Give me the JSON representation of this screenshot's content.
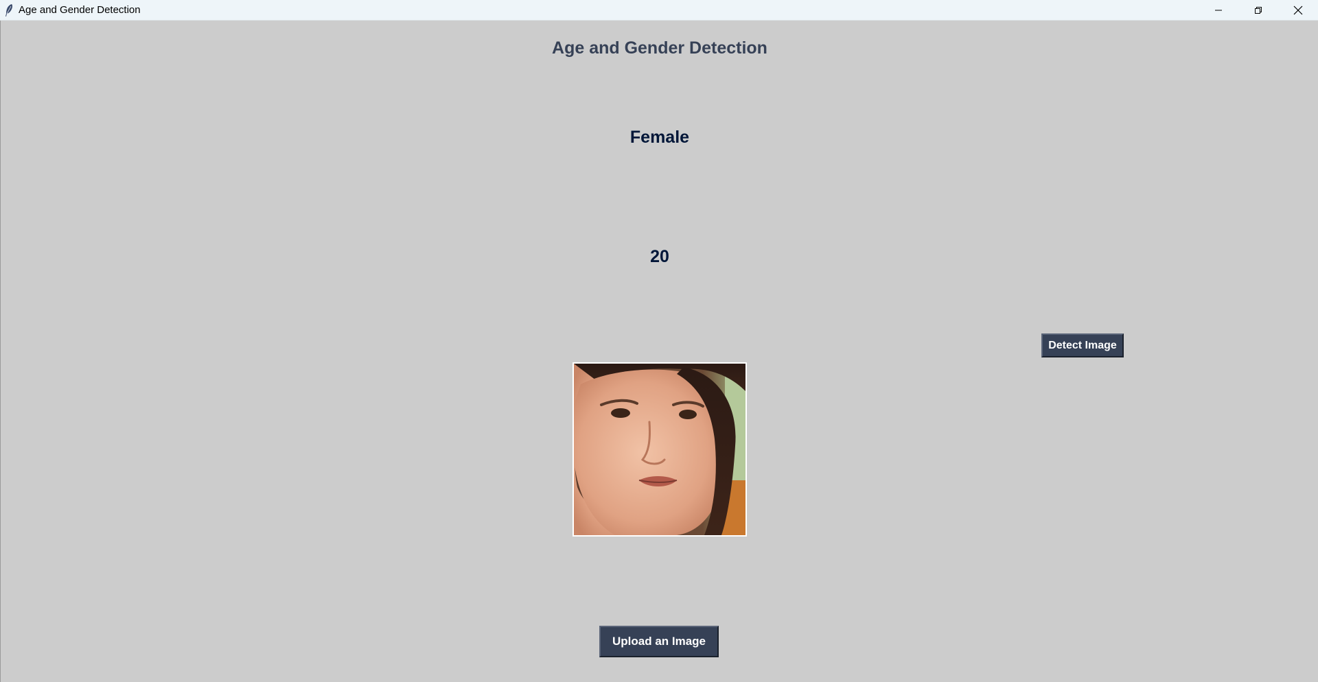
{
  "window": {
    "title": "Age and Gender Detection"
  },
  "app": {
    "heading": "Age and Gender Detection",
    "gender_result": "Female",
    "age_result": "20",
    "detect_button_label": "Detect Image",
    "upload_button_label": "Upload an Image",
    "uploaded_image": "face-photo"
  },
  "colors": {
    "background": "#cccccc",
    "heading": "#364156",
    "result_text": "#011638",
    "button_bg": "#364156",
    "button_text": "#ffffff"
  },
  "icons": {
    "app_icon": "feather-icon",
    "minimize": "minimize-icon",
    "maximize": "restore-icon",
    "close": "close-icon"
  }
}
